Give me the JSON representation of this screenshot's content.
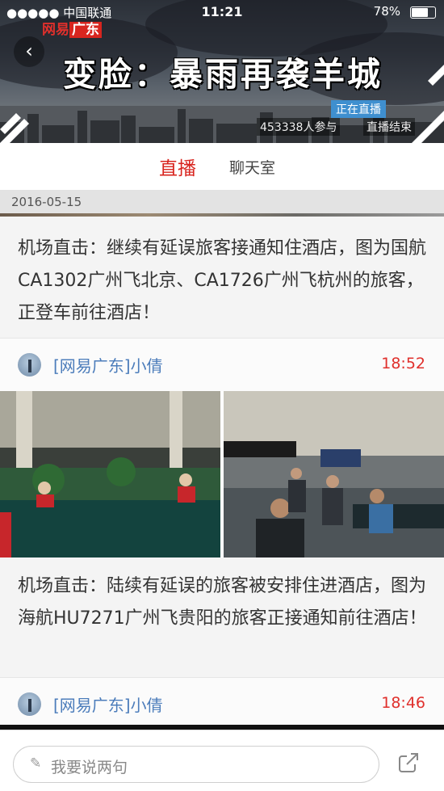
{
  "status_bar": {
    "carrier": "●●●●● 中国联通",
    "time": "11:21",
    "battery": "78%",
    "battery_level": 0.78
  },
  "header": {
    "logo_prefix": "网易",
    "logo_box": "广东",
    "title": "变脸：暴雨再袭羊城",
    "live_badge": "正在直播",
    "participants": "453338人参与",
    "ended": "直播结束"
  },
  "tabs": [
    {
      "label": "直播",
      "active": true
    },
    {
      "label": "聊天室",
      "active": false
    }
  ],
  "date": "2016-05-15",
  "posts": [
    {
      "text": "机场直击：继续有延误旅客接通知住酒店，图为国航CA1302广州飞北京、CA1726广州飞杭州的旅客，正登车前往酒店！",
      "author": "[网易广东]小倩",
      "time": "18:52"
    },
    {
      "text": "机场直击：陆续有延误的旅客被安排住进酒店，图为海航HU7271广州飞贵阳的旅客正接通知前往酒店！",
      "author": "[网易广东]小倩",
      "time": "18:46"
    }
  ],
  "comment_placeholder": "我要说两句",
  "icons": {
    "back": "back-chevron-icon",
    "pen": "pen-icon",
    "share": "share-icon"
  },
  "colors": {
    "accent": "#d8251f",
    "author": "#4c7dbb",
    "time": "#e0302c",
    "live_badge": "#3f8fcf"
  }
}
